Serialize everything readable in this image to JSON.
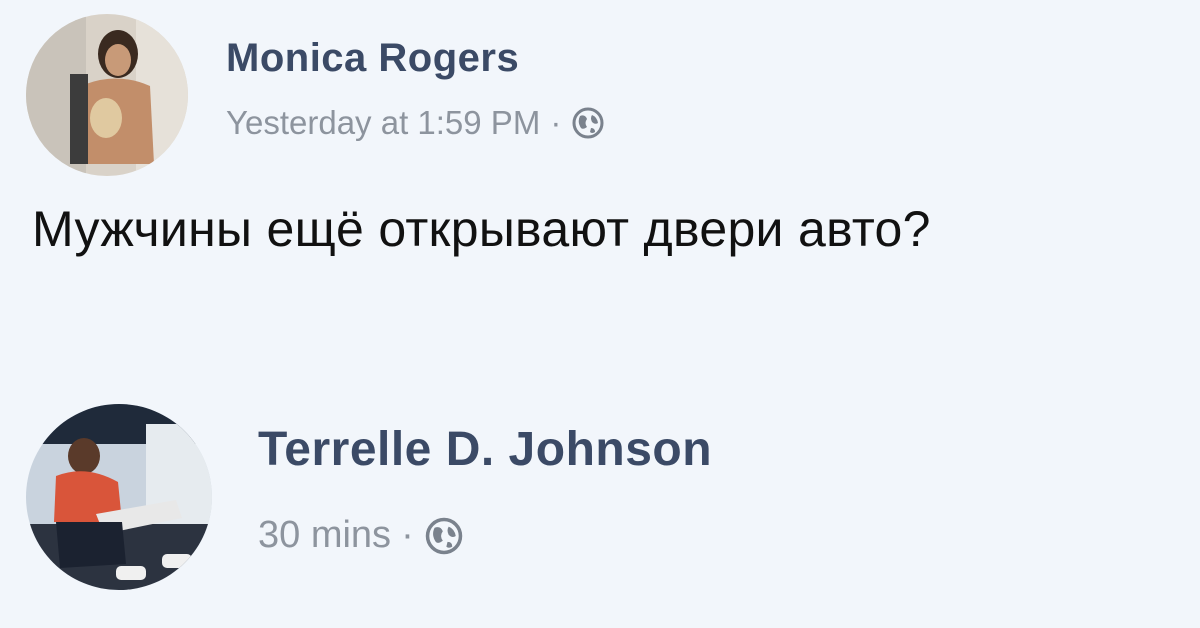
{
  "post": {
    "author": "Monica Rogers",
    "timestamp": "Yesterday at 1:59 PM",
    "separator": "·",
    "privacy_icon": "globe-icon",
    "text": "Мужчины ещё открывают двери авто?"
  },
  "comment": {
    "author": "Terrelle D. Johnson",
    "timestamp": "30 mins",
    "separator": "·",
    "privacy_icon": "globe-icon"
  },
  "colors": {
    "background": "#f2f6fb",
    "name": "#3b4a66",
    "meta": "#8d949e",
    "body_text": "#111111"
  }
}
